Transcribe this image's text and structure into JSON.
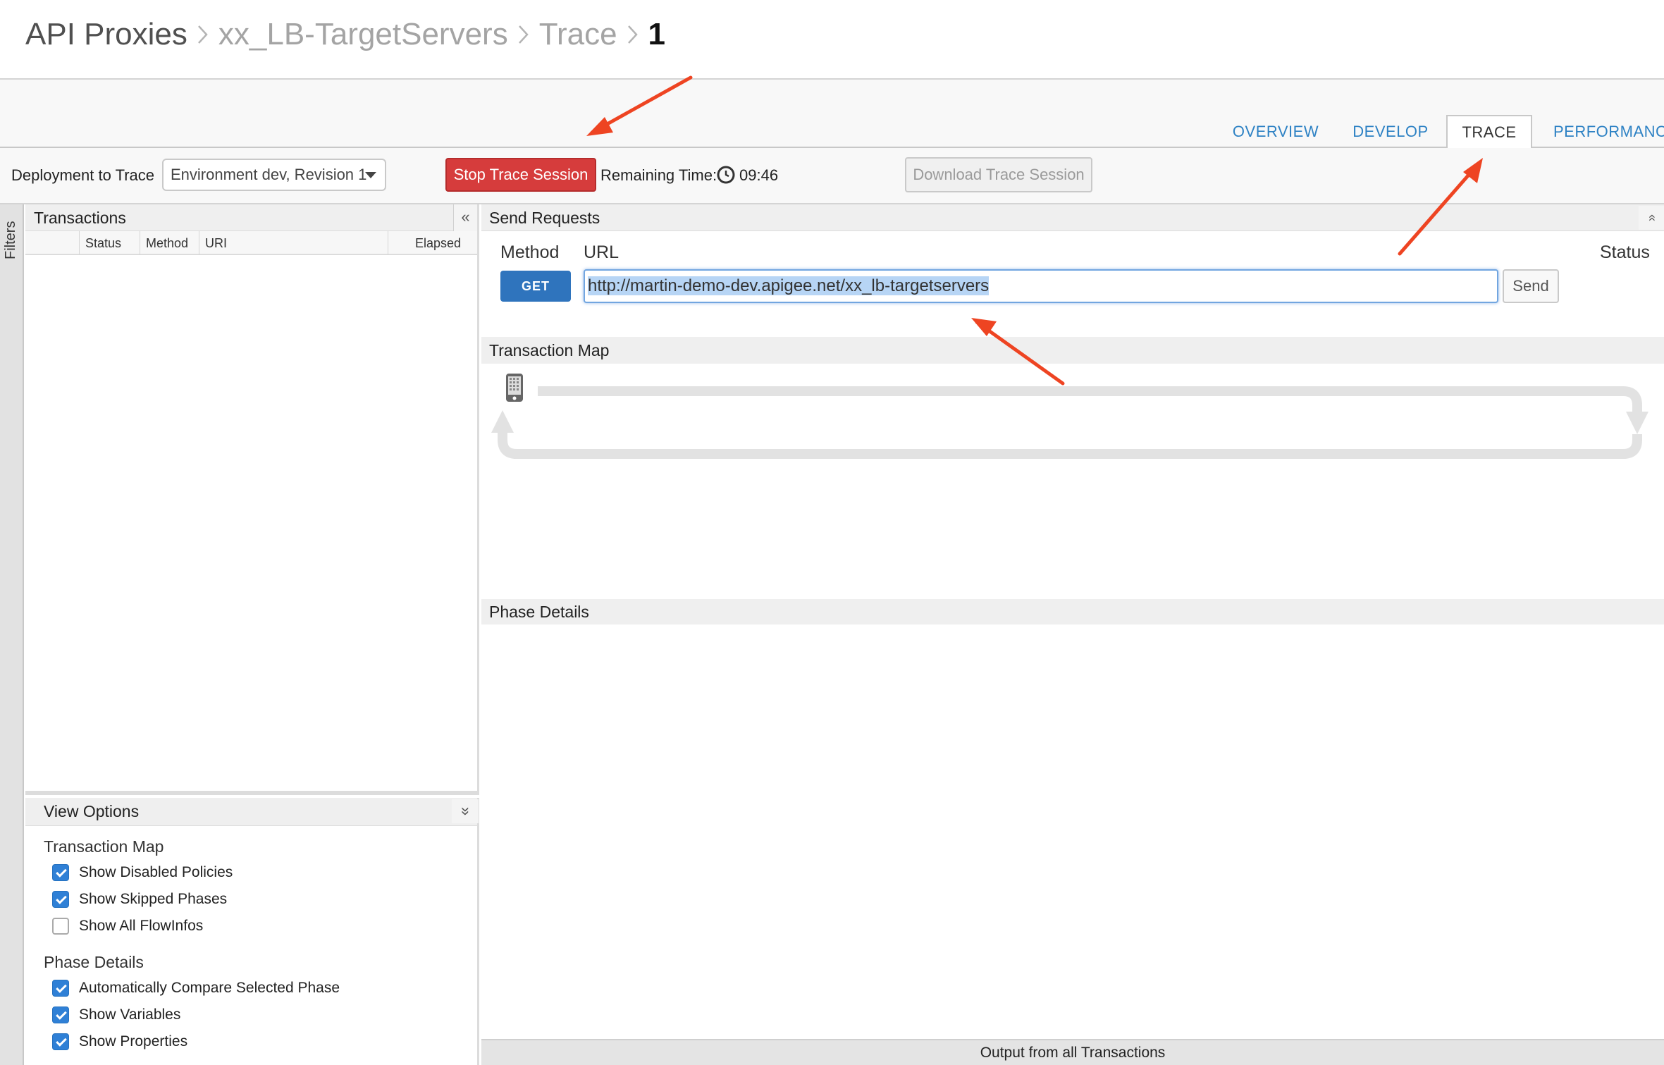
{
  "breadcrumb": {
    "items": [
      "API Proxies",
      "xx_LB-TargetServers",
      "Trace",
      "1"
    ]
  },
  "tabs": {
    "overview": "OVERVIEW",
    "develop": "DEVELOP",
    "trace": "TRACE",
    "performance": "PERFORMANCE",
    "active": "TRACE"
  },
  "toolbar": {
    "deployment_label": "Deployment to Trace",
    "deployment_value": "Environment dev, Revision 1",
    "stop_label": "Stop Trace Session",
    "remaining_label": "Remaining Time:",
    "remaining_value": "09:46",
    "download_label": "Download Trace Session"
  },
  "filters": {
    "label": "Filters"
  },
  "transactions": {
    "title": "Transactions",
    "collapse_glyph": "«",
    "columns": [
      "Status",
      "Method",
      "URI",
      "Elapsed"
    ]
  },
  "view_options": {
    "title": "View Options",
    "collapse_glyph": "»",
    "sections": [
      {
        "title": "Transaction Map",
        "items": [
          {
            "label": "Show Disabled Policies",
            "checked": true
          },
          {
            "label": "Show Skipped Phases",
            "checked": true
          },
          {
            "label": "Show All FlowInfos",
            "checked": false
          }
        ]
      },
      {
        "title": "Phase Details",
        "items": [
          {
            "label": "Automatically Compare Selected Phase",
            "checked": true
          },
          {
            "label": "Show Variables",
            "checked": true
          },
          {
            "label": "Show Properties",
            "checked": true
          }
        ]
      }
    ]
  },
  "send_requests": {
    "title": "Send Requests",
    "method_label": "Method",
    "url_label": "URL",
    "status_label": "Status",
    "method_value": "GET",
    "url_value": "http://martin-demo-dev.apigee.net/xx_lb-targetservers",
    "send_label": "Send",
    "collapse_glyph": "»"
  },
  "transaction_map": {
    "title": "Transaction Map"
  },
  "phase_details": {
    "title": "Phase Details"
  },
  "output": {
    "label": "Output from all Transactions"
  },
  "colors": {
    "accent_blue": "#2f74bd",
    "tab_blue": "#2e82c4",
    "stop_red": "#d63c3c",
    "annotation_arrow": "#ee4422"
  },
  "icons": {
    "clock": "clock-icon",
    "phone": "mobile-device-icon",
    "caret": "caret-down-icon"
  }
}
